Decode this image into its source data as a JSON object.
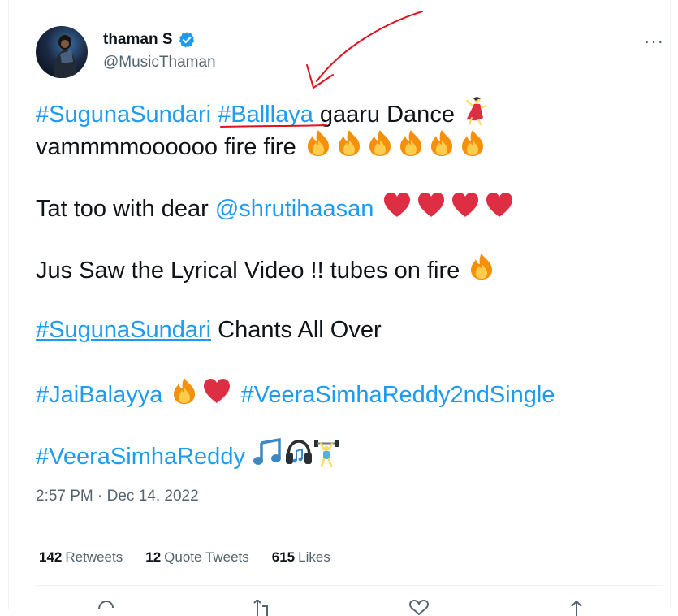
{
  "author": {
    "display_name": "thaman S",
    "username": "@MusicThaman"
  },
  "header": {
    "more_label": "···"
  },
  "tweet": {
    "line1_tag1": "#SugunaSundari",
    "line1_tag2": "#Balllaya",
    "line1_text": " gaaru Dance ",
    "line2_text": "vammmmoooooo fire fire ",
    "line3_text": "Tat too with dear ",
    "line3_mention": "@shrutihaasan",
    "line4_text": "Jus Saw the Lyrical Video !! tubes on fire ",
    "line5_tag": "#SugunaSundari",
    "line5_text": " Chants All Over",
    "line6_tag1": "#JaiBalayya",
    "line6_tag2": "#VeeraSimhaReddy2ndSingle",
    "line7_tag": "#VeeraSimhaReddy"
  },
  "timestamp": "2:57 PM · Dec 14, 2022",
  "stats": {
    "retweets_count": "142",
    "retweets_label": "Retweets",
    "quotes_count": "12",
    "quotes_label": "Quote Tweets",
    "likes_count": "615",
    "likes_label": "Likes"
  },
  "icons": {
    "verified": "verified-badge-icon",
    "fire": "fire-emoji",
    "heart": "red-heart-emoji",
    "dancer": "dancer-emoji",
    "music": "music-notes-emoji",
    "headphone": "headphone-emoji",
    "weightlifter": "weightlifter-emoji"
  },
  "colors": {
    "link": "#1d9bf0",
    "text": "#0f1419",
    "muted": "#536471",
    "annotation": "#e0141c"
  }
}
